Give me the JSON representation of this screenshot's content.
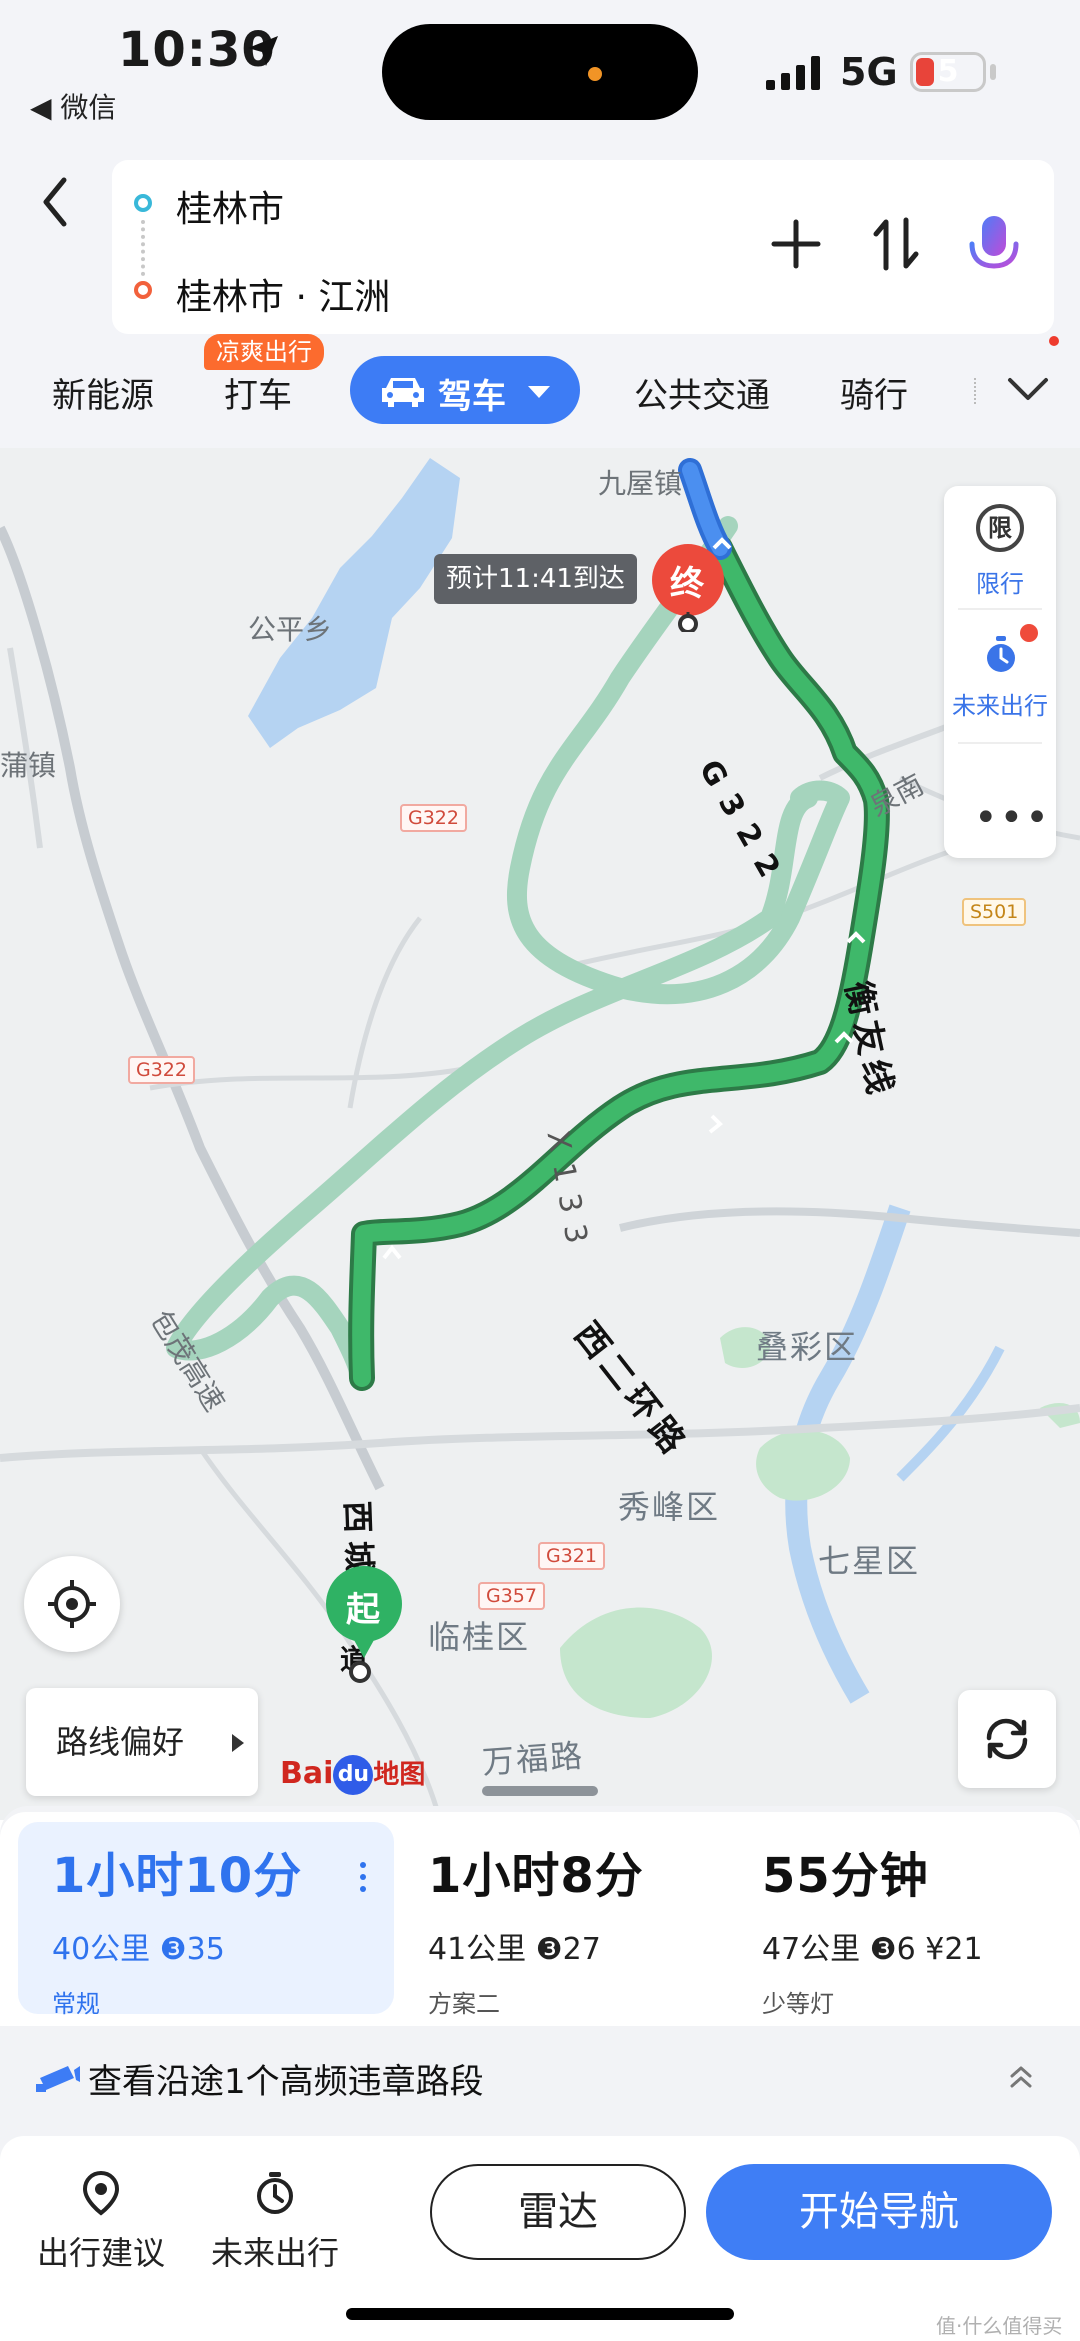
{
  "status_bar": {
    "time": "10:30",
    "back_app": "◀ 微信",
    "network": "5G",
    "battery": "5"
  },
  "route": {
    "start": "桂林市",
    "end": "桂林市 · 江洲"
  },
  "tabs": {
    "new_energy": "新能源",
    "taxi": "打车",
    "taxi_promo": "凉爽出行",
    "drive": "驾车",
    "transit": "公共交通",
    "bike": "骑行"
  },
  "map": {
    "eta_tip": "预计11:41到达",
    "end_marker": "终",
    "start_marker": "起",
    "places": {
      "jiuwu": "九屋镇",
      "gongping": "公平乡",
      "pu": "蒲镇",
      "quannan": "泉南",
      "diecai": "叠彩区",
      "xiufeng": "秀峰区",
      "qixing": "七星区",
      "lingui": "临桂区",
      "wanfu": "万福路",
      "baomao": "包茂高速"
    },
    "roads": {
      "g322_route": "G322",
      "hengyou": "衡友线",
      "x133": "X133",
      "xierhuan": "西二环路",
      "xicheng": "西城",
      "xicheng_tail": "道"
    },
    "shields": {
      "g322_a": "G322",
      "g322_b": "G322",
      "s501": "S501",
      "g321": "G321",
      "g357": "G357"
    },
    "side_panel": {
      "limit_icon": "限",
      "limit": "限行",
      "future": "未来出行",
      "more": "•••"
    },
    "route_pref": "路线偏好",
    "logo_bai": "Bai",
    "logo_du": "du",
    "logo_map": "地图",
    "colors": {
      "main_route": "#3fb86a",
      "alt_route": "#a5d4bd",
      "final_segment": "#4b8ff0",
      "water": "#b5d3f2",
      "green": "#c5e6cd"
    }
  },
  "routes": [
    {
      "duration": "1小时10分",
      "distance": "40公里",
      "lights": "35",
      "fee": "",
      "tag": "常规"
    },
    {
      "duration": "1小时8分",
      "distance": "41公里",
      "lights": "27",
      "fee": "",
      "tag": "方案二"
    },
    {
      "duration": "55分钟",
      "distance": "47公里",
      "lights": "6",
      "fee": "¥21",
      "tag": "少等灯"
    }
  ],
  "violation": {
    "text": "查看沿途1个高频违章路段"
  },
  "bottom": {
    "suggest": "出行建议",
    "future": "未来出行",
    "radar": "雷达",
    "navigate": "开始导航"
  },
  "watermark": "值·什么值得买"
}
